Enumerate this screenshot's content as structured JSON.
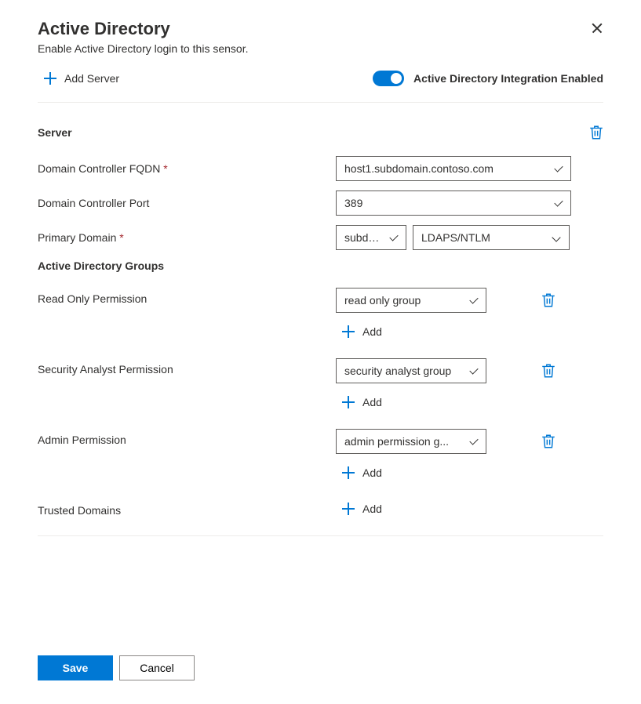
{
  "title": "Active Directory",
  "subtitle": "Enable Active Directory login to this sensor.",
  "addServer": "Add Server",
  "toggleLabel": "Active Directory Integration Enabled",
  "toggleState": true,
  "serverSection": "Server",
  "fields": {
    "fqdnLabel": "Domain Controller FQDN",
    "fqdnValue": "host1.subdomain.contoso.com",
    "portLabel": "Domain Controller Port",
    "portValue": "389",
    "primaryDomainLabel": "Primary Domain",
    "primaryDomainValue": "subdo...",
    "protocolValue": "LDAPS/NTLM"
  },
  "groupsTitle": "Active Directory Groups",
  "groups": {
    "readOnly": {
      "label": "Read Only Permission",
      "value": "read only group"
    },
    "securityAnalyst": {
      "label": "Security Analyst Permission",
      "value": "security analyst group"
    },
    "admin": {
      "label": "Admin Permission",
      "value": "admin permission g..."
    },
    "trusted": {
      "label": "Trusted Domains"
    }
  },
  "addLabel": "Add",
  "buttons": {
    "save": "Save",
    "cancel": "Cancel"
  },
  "colors": {
    "primary": "#0078d4"
  }
}
